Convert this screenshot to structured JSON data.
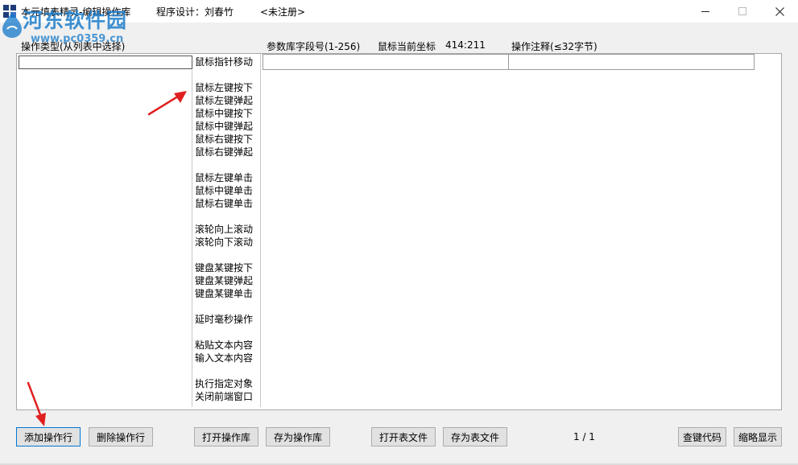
{
  "window": {
    "title_app": "本元填表精灵-编辑操作库",
    "title_author": "程序设计：刘春竹",
    "title_status": "<未注册>"
  },
  "watermark": {
    "site_name": "河东软件园",
    "url": "www.pc0359.cn"
  },
  "header": {
    "op_type_label": "操作类型(从列表中选择)",
    "field_label": "参数库字段号(1-256)",
    "mouse_pos_label": "鼠标当前坐标",
    "mouse_pos_value": "414:211",
    "comment_label": "操作注释(≤32字节)"
  },
  "op_list": [
    "鼠标指针移动",
    "鼠标左键按下",
    "鼠标左键弹起",
    "鼠标中键按下",
    "鼠标中键弹起",
    "鼠标右键按下",
    "鼠标右键弹起",
    "鼠标左键单击",
    "鼠标中键单击",
    "鼠标右键单击",
    "滚轮向上滚动",
    "滚轮向下滚动",
    "键盘某键按下",
    "键盘某键弹起",
    "键盘某键单击",
    "延时毫秒操作",
    "粘贴文本内容",
    "输入文本内容",
    "执行指定对象",
    "关闭前端窗口"
  ],
  "buttons": {
    "add_row": "添加操作行",
    "delete_row": "删除操作行",
    "open_lib": "打开操作库",
    "save_lib": "存为操作库",
    "open_table": "打开表文件",
    "save_table": "存为表文件",
    "key_code": "查键代码",
    "compact": "缩略显示"
  },
  "pagination": {
    "text": "1 / 1"
  },
  "colors": {
    "annotation_arrow": "#e02020",
    "watermark": "#1478c8",
    "focus_border": "#0078d7"
  }
}
